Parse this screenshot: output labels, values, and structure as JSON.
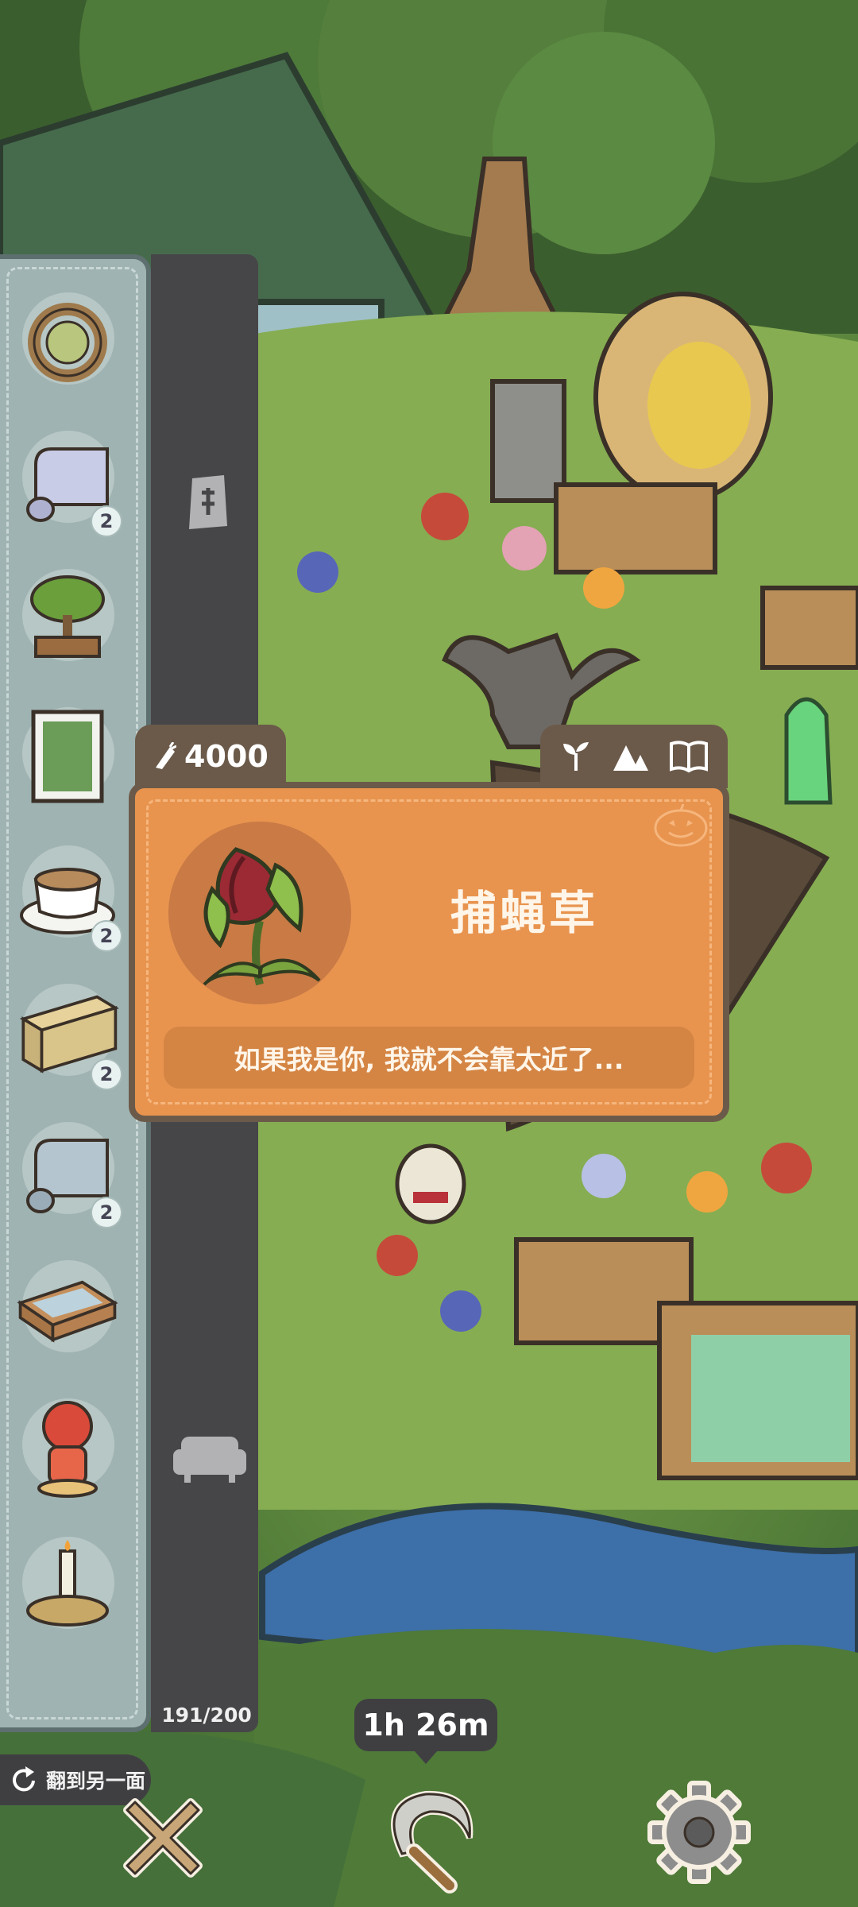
{
  "price": {
    "icon": "carrot-icon",
    "value": "4000"
  },
  "card_tabs": [
    "sprout-icon",
    "mountain-icon",
    "book-icon"
  ],
  "item": {
    "name": "捕蝇草",
    "quote": "如果我是你, 我就不会靠太近了...",
    "image": "flytrap-plant-icon"
  },
  "inventory": {
    "capacity": "191/200",
    "items": [
      {
        "icon": "wreath-icon",
        "count": ""
      },
      {
        "icon": "wallpaper-roll-icon",
        "count": "2"
      },
      {
        "icon": "bonsai-tree-icon",
        "count": ""
      },
      {
        "icon": "picture-frame-icon",
        "count": ""
      },
      {
        "icon": "coffee-cup-icon",
        "count": "2"
      },
      {
        "icon": "wooden-cabinet-icon",
        "count": "2"
      },
      {
        "icon": "floor-roll-icon",
        "count": "2"
      },
      {
        "icon": "glass-table-icon",
        "count": ""
      },
      {
        "icon": "red-figurine-icon",
        "count": ""
      },
      {
        "icon": "candle-holder-icon",
        "count": ""
      }
    ]
  },
  "categories": [
    "seed-bag-icon",
    "sofa-icon"
  ],
  "flip_button": {
    "icon": "rotate-icon",
    "label": "翻到另一面"
  },
  "timer": "1h 26m",
  "bottom_buttons": [
    "close-icon",
    "sickle-icon",
    "settings-gear-icon"
  ],
  "colors": {
    "card": "#e8944f",
    "card_border": "#6b5a4a",
    "panel": "#9fb3b2",
    "dark_bar": "#464648"
  }
}
